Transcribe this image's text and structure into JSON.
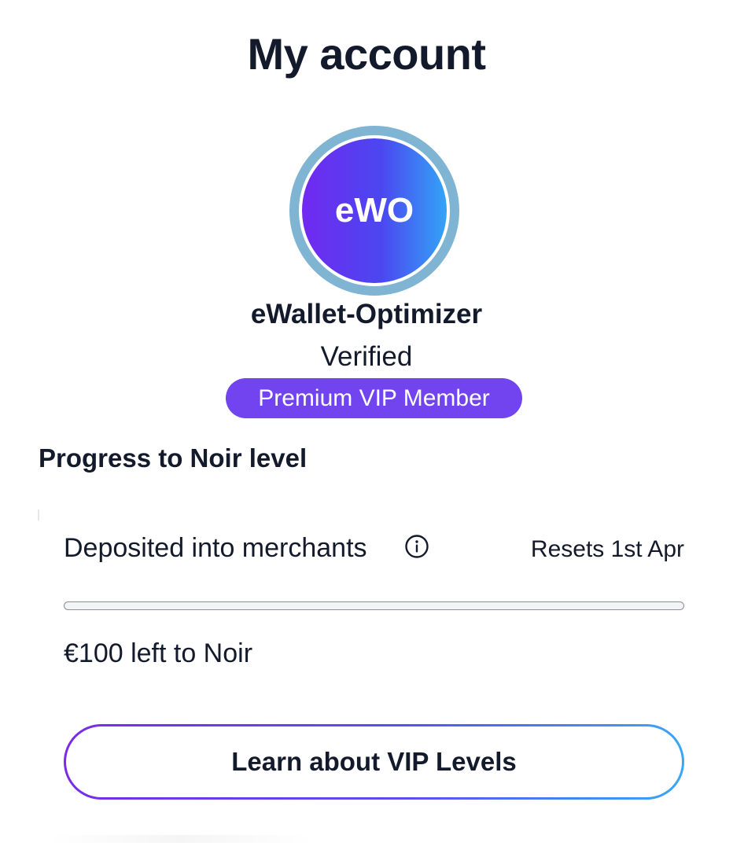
{
  "page": {
    "title": "My account"
  },
  "profile": {
    "avatar_initials": "eWO",
    "username": "eWallet-Optimizer",
    "status": "Verified",
    "badge": "Premium VIP Member"
  },
  "progress": {
    "heading": "Progress to Noir level",
    "metric_label": "Deposited into merchants",
    "info_icon": "info-circle-icon",
    "reset_text": "Resets 1st Apr",
    "fill_fraction": 0,
    "remaining_text": "€100 left to Noir"
  },
  "actions": {
    "learn_label": "Learn about VIP Levels"
  },
  "colors": {
    "accent": "#7244f0",
    "ring": "#7fb4d3",
    "gradient_start": "#7129f0",
    "gradient_end": "#33a4f7",
    "text": "#131a2b"
  }
}
